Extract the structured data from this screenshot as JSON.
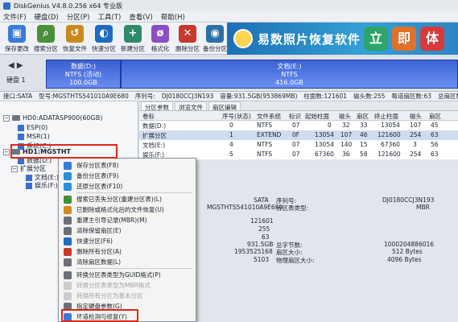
{
  "window": {
    "title": "DiskGenius V4.8.0.256 x64 专业版"
  },
  "menu": [
    "文件(F)",
    "硬盘(D)",
    "分区(P)",
    "工具(T)",
    "查看(V)",
    "帮助(H)"
  ],
  "toolbar": [
    {
      "label": "保存更改",
      "icon": "save-icon",
      "color": "#3b7bd8",
      "glyph": "▣"
    },
    {
      "label": "搜索分区",
      "icon": "search-icon",
      "color": "#4a8f3a",
      "glyph": "⌕"
    },
    {
      "label": "恢复文件",
      "icon": "recover-icon",
      "color": "#c88a1d",
      "glyph": "↺"
    },
    {
      "label": "快速分区",
      "icon": "quick-partition-icon",
      "color": "#1e6bc0",
      "glyph": "◐"
    },
    {
      "label": "新建分区",
      "icon": "new-partition-icon",
      "color": "#2f8a6b",
      "glyph": "+"
    },
    {
      "label": "格式化",
      "icon": "format-icon",
      "color": "#8a4fc0",
      "glyph": "ø"
    },
    {
      "label": "删除分区",
      "icon": "delete-partition-icon",
      "color": "#c8382c",
      "glyph": "✕"
    },
    {
      "label": "备份分区",
      "icon": "backup-partition-icon",
      "color": "#2a6fa8",
      "glyph": "◉"
    }
  ],
  "banner": {
    "text": "易数照片恢复软件",
    "buttons": [
      {
        "label": "立",
        "color": "#2ea36b"
      },
      {
        "label": "即",
        "color": "#e0712b"
      },
      {
        "label": "体",
        "color": "#d63b3b"
      }
    ]
  },
  "diskbar": {
    "label": "硬盘 1",
    "partitions": [
      {
        "name": "数据(D:)",
        "fs": "NTFS (活动)",
        "size": "100.0GB"
      },
      {
        "name": "文档(E:)",
        "fs": "NTFS",
        "size": "416.0GB"
      }
    ]
  },
  "infoline": [
    "接口:SATA",
    "型号:MGSTHTS541010A9E680",
    "序列号:",
    "DJ0180CCJ3N193",
    "容量:931.5GB(953869MB)",
    "柱面数:121601",
    "磁头数:255",
    "每道扇区数:63",
    "总扇区数:1953525168"
  ],
  "tree": [
    {
      "label": "HD0:ADATASP900(60GB)",
      "kind": "disk"
    },
    {
      "label": "ESP(0)",
      "kind": "part"
    },
    {
      "label": "MSR(1)",
      "kind": "part"
    },
    {
      "label": "系统(C:)",
      "kind": "part"
    },
    {
      "label": "HD1:MGSTHT",
      "kind": "disk"
    },
    {
      "label": "数据(D:)",
      "kind": "part"
    },
    {
      "label": "扩展分区",
      "kind": "part"
    },
    {
      "label": "文档(E:)",
      "kind": "part"
    },
    {
      "label": "娱乐(F:)",
      "kind": "part"
    }
  ],
  "tabs": [
    "分区参数",
    "浏览文件",
    "扇区编辑"
  ],
  "partition_table": {
    "headers": [
      "卷标",
      "序号(状态)",
      "文件系统",
      "标识",
      "起始柱面",
      "磁头",
      "扇区",
      "终止柱面",
      "磁头",
      "扇区"
    ],
    "rows": [
      [
        "数据(D:)",
        "0",
        "NTFS",
        "07",
        "0",
        "32",
        "33",
        "13054",
        "107",
        "45"
      ],
      [
        "扩展分区",
        "1",
        "EXTEND",
        "0F",
        "13054",
        "107",
        "46",
        "121600",
        "254",
        "63"
      ],
      [
        "文档(E:)",
        "4",
        "NTFS",
        "07",
        "13054",
        "140",
        "15",
        "67360",
        "3",
        "56"
      ],
      [
        "娱乐(F:)",
        "5",
        "NTFS",
        "07",
        "67360",
        "36",
        "58",
        "121600",
        "254",
        "63"
      ]
    ]
  },
  "details": {
    "col1": [
      "SATA",
      "MGSTHTS541010A9E680",
      "",
      "121601",
      "255",
      "63",
      "931.5GB",
      "1953525168",
      "5103"
    ],
    "col2": [
      "序列号:",
      "分区表类型:",
      "",
      "",
      "",
      "",
      "总字节数:",
      "扇区大小:",
      "物理扇区大小:"
    ],
    "col3": [
      "DJ0180CCJ3N193",
      "MBR",
      "",
      "",
      "",
      "",
      "1000204886016",
      "512 Bytes",
      "4096 Bytes"
    ]
  },
  "context_menu": [
    {
      "label": "保存分区表(F8)",
      "icon": "save-table-icon",
      "color": "#3b7bd8",
      "enabled": true
    },
    {
      "label": "备份分区表(F9)",
      "icon": "backup-table-icon",
      "color": "#2a8fd6",
      "enabled": true
    },
    {
      "label": "还原分区表(F10)",
      "icon": "restore-table-icon",
      "color": "#2a8fd6",
      "enabled": true
    },
    {
      "sep": true
    },
    {
      "label": "搜索已丢失分区(重建分区表)(L)",
      "icon": "search-lost-icon",
      "color": "#3e8f3a",
      "enabled": true
    },
    {
      "label": "已删除或格式化后的文件恢复(U)",
      "icon": "file-recover-icon",
      "color": "#d08a1d",
      "enabled": true
    },
    {
      "label": "重建主引导记录(MBR)(M)",
      "icon": "mbr-icon",
      "color": "#6a6f78",
      "enabled": true
    },
    {
      "label": "清除保留扇区(E)",
      "icon": "clear-sector-icon",
      "color": "#6a6f78",
      "enabled": true
    },
    {
      "label": "快速分区(F6)",
      "icon": "quick-partition-icon",
      "color": "#1e6bc0",
      "enabled": true
    },
    {
      "label": "删除所有分区(A)",
      "icon": "delete-all-icon",
      "color": "#c8382c",
      "enabled": true
    },
    {
      "label": "清除扇区数据(L)",
      "icon": "erase-icon",
      "color": "#6a6f78",
      "enabled": true
    },
    {
      "sep": true
    },
    {
      "label": "转换分区表类型为GUID格式(P)",
      "icon": "convert-guid-icon",
      "color": "#6a6f78",
      "enabled": true
    },
    {
      "label": "转换分区表类型为MBR格式",
      "icon": "convert-mbr-icon",
      "color": "#6a6f78",
      "enabled": false
    },
    {
      "label": "转换所有分区为基本分区",
      "icon": "convert-basic-icon",
      "color": "#6a6f78",
      "enabled": false
    },
    {
      "label": "指定硬盘参数(G)",
      "icon": "disk-param-icon",
      "color": "#6a6f78",
      "enabled": true
    },
    {
      "label": "坏道检测与修复(Y)",
      "icon": "bad-sector-icon",
      "color": "#3b7bd8",
      "enabled": true
    }
  ]
}
